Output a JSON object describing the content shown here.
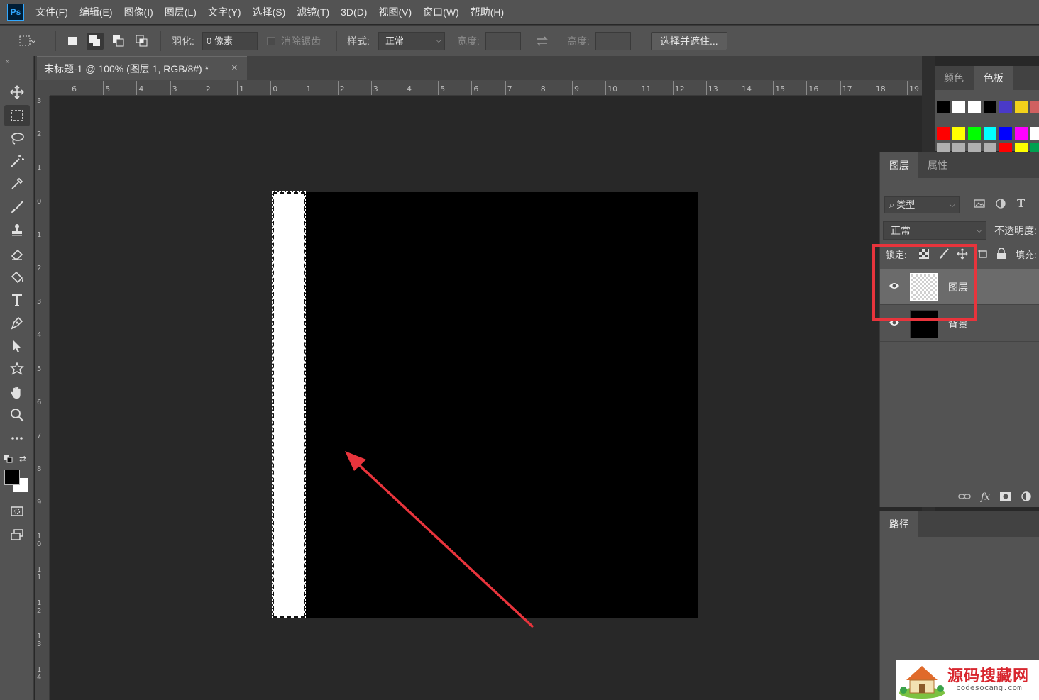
{
  "app": {
    "logo_text": "Ps"
  },
  "menu": [
    "文件(F)",
    "编辑(E)",
    "图像(I)",
    "图层(L)",
    "文字(Y)",
    "选择(S)",
    "滤镜(T)",
    "3D(D)",
    "视图(V)",
    "窗口(W)",
    "帮助(H)"
  ],
  "options": {
    "feather_label": "羽化:",
    "feather_value": "0 像素",
    "antialias_label": "消除锯齿",
    "style_label": "样式:",
    "style_value": "正常",
    "width_label": "宽度:",
    "height_label": "高度:",
    "select_mask_button": "选择并遮住..."
  },
  "document": {
    "tab_title": "未标题-1 @ 100% (图层 1, RGB/8#) *",
    "close_glyph": "×"
  },
  "rulers": {
    "horizontal": [
      "6",
      "5",
      "4",
      "3",
      "2",
      "1",
      "0",
      "1",
      "2",
      "3",
      "4",
      "5",
      "6",
      "7",
      "8",
      "9",
      "10",
      "11",
      "12",
      "13",
      "14",
      "15",
      "16",
      "17",
      "18",
      "19"
    ],
    "vertical": [
      "3",
      "2",
      "1",
      "0",
      "1",
      "2",
      "3",
      "4",
      "5",
      "6",
      "7",
      "8",
      "9",
      "10",
      "11",
      "12",
      "13",
      "14"
    ]
  },
  "swatch_panel": {
    "tabs": [
      "颜色",
      "色板"
    ],
    "active_tab": "色板",
    "row1": [
      "#000000",
      "#ffffff",
      "#ffffff",
      "#000000",
      "#4a3ac8",
      "#f2d21b",
      "#d06060"
    ],
    "row2": [
      "#ff0000",
      "#ffff00",
      "#00ff00",
      "#00ffff",
      "#0000ff",
      "#ff00ff",
      "#ffffff"
    ],
    "row3": [
      "#b0b0b0",
      "#b0b0b0",
      "#b0b0b0",
      "#b0b0b0",
      "#ff0000",
      "#ffff00",
      "#00a050"
    ]
  },
  "layers_panel": {
    "tabs": [
      "图层",
      "属性"
    ],
    "active_tab": "图层",
    "filter_label": "类型",
    "blend_mode": "正常",
    "opacity_label": "不透明度:",
    "lock_label": "锁定:",
    "fill_label": "填充:",
    "layers": [
      {
        "name": "图层",
        "visible": true,
        "selected": true,
        "thumb": "transparent"
      },
      {
        "name": "背景",
        "visible": true,
        "selected": false,
        "thumb": "black"
      }
    ],
    "footer_fx": "fx"
  },
  "paths_panel": {
    "tabs": [
      "路径"
    ]
  },
  "watermark": {
    "title": "源码搜藏网",
    "url": "codesocang.com"
  },
  "colors": {
    "annotation_red": "#e8343c",
    "foreground": "#000000",
    "background": "#ffffff"
  }
}
